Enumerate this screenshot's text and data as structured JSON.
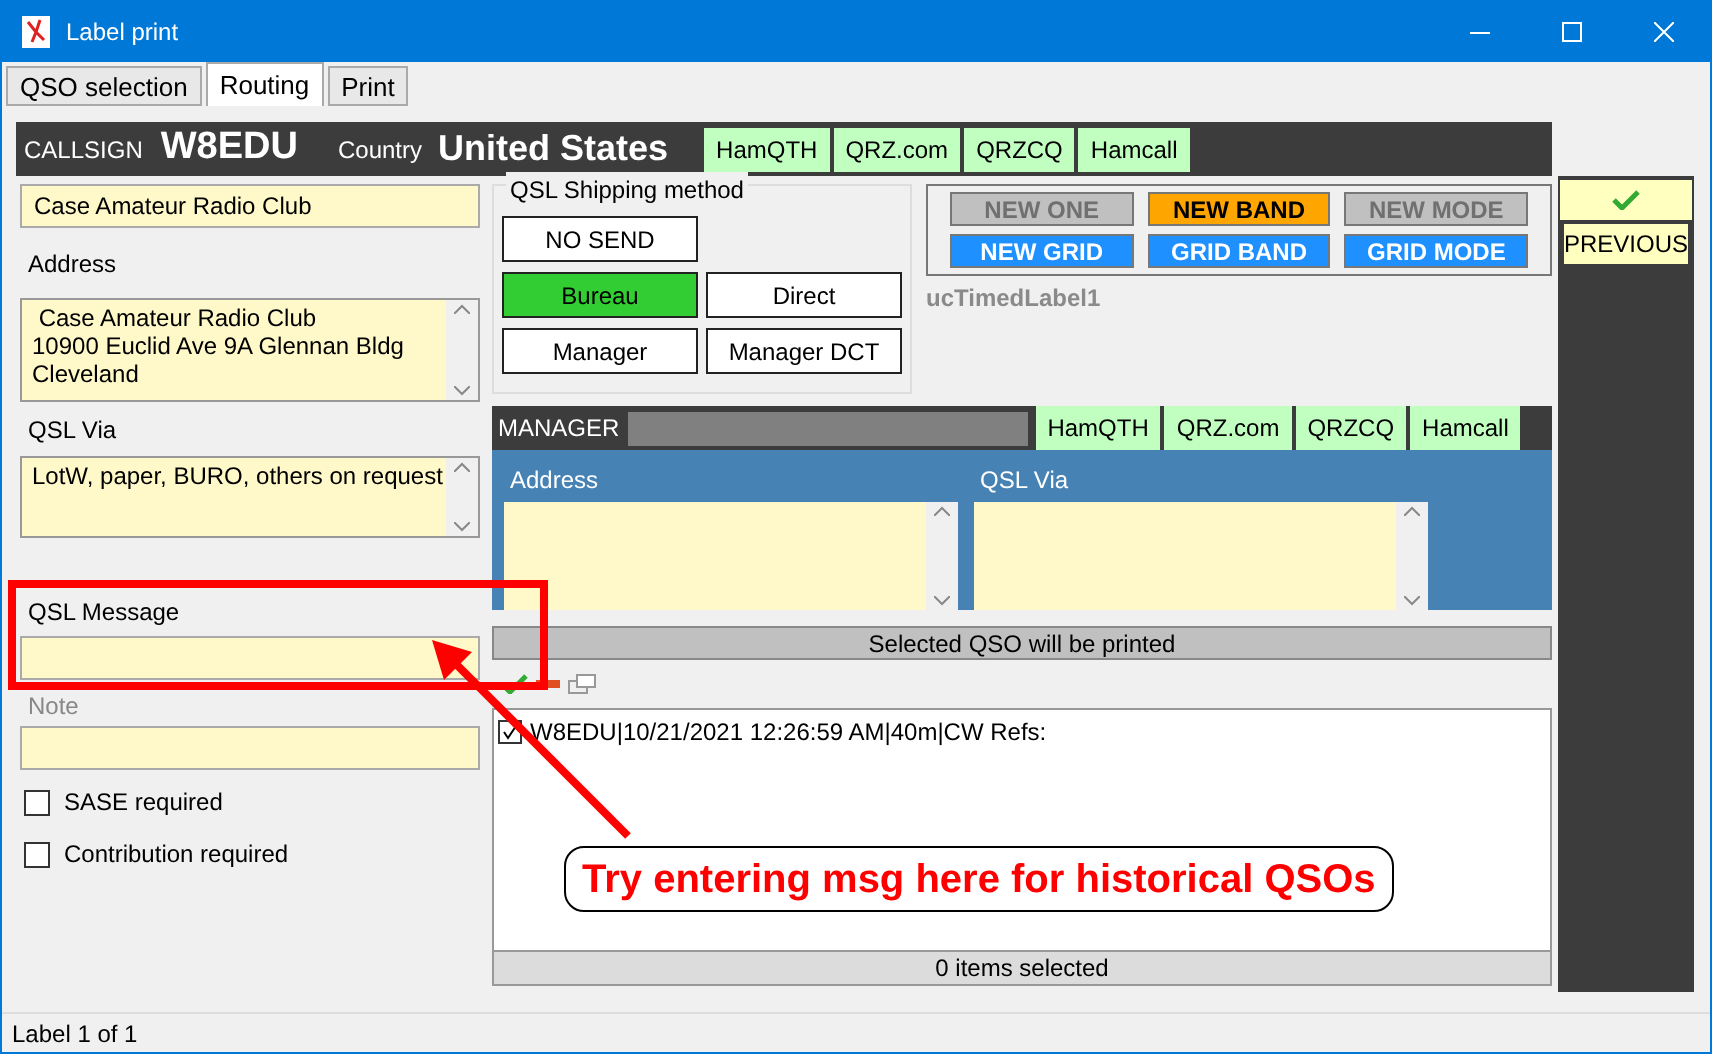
{
  "window": {
    "title": "Label print"
  },
  "tabs": [
    {
      "label": "QSO selection",
      "selected": false
    },
    {
      "label": "Routing",
      "selected": true
    },
    {
      "label": "Print",
      "selected": false
    }
  ],
  "callsign": {
    "label": "CALLSIGN",
    "value": "W8EDU"
  },
  "country": {
    "label": "Country",
    "value": "United States"
  },
  "lookup_buttons": [
    "HamQTH",
    "QRZ.com",
    "QRZCQ",
    "Hamcall"
  ],
  "name_field": {
    "value": "Case Amateur Radio Club"
  },
  "address": {
    "label": "Address",
    "lines": [
      " Case Amateur Radio Club",
      "10900 Euclid Ave 9A Glennan Bldg",
      "Cleveland"
    ]
  },
  "qsl_via": {
    "label": "QSL Via",
    "value": "LotW, paper, BURO, others on request"
  },
  "qsl_message": {
    "label": "QSL Message"
  },
  "note": {
    "label": "Note"
  },
  "checkboxes": [
    {
      "label": "SASE required",
      "checked": false
    },
    {
      "label": "Contribution required",
      "checked": false
    }
  ],
  "shipping": {
    "title": "QSL Shipping method",
    "buttons": [
      {
        "label": "NO SEND",
        "selected": false
      },
      {
        "label": "Bureau",
        "selected": true
      },
      {
        "label": "Direct",
        "selected": false
      },
      {
        "label": "Manager",
        "selected": false
      },
      {
        "label": "Manager DCT",
        "selected": false
      }
    ]
  },
  "award_flags": [
    {
      "label": "NEW ONE",
      "kind": "off",
      "color": "#c0c0c0"
    },
    {
      "label": "NEW BAND",
      "kind": "on",
      "color": "#ffa500"
    },
    {
      "label": "NEW MODE",
      "kind": "off",
      "color": "#c0c0c0"
    },
    {
      "label": "NEW GRID",
      "kind": "grid",
      "color": "#1e90ff"
    },
    {
      "label": "GRID BAND",
      "kind": "grid",
      "color": "#1e90ff"
    },
    {
      "label": "GRID MODE",
      "kind": "grid",
      "color": "#1e90ff"
    }
  ],
  "timed_label": "ucTimedLabel1",
  "side_panel": {
    "previous": "PREVIOUS"
  },
  "manager": {
    "label": "MANAGER",
    "lookup_buttons": [
      "HamQTH",
      "QRZ.com",
      "QRZCQ",
      "Hamcall"
    ],
    "address_label": "Address",
    "qsl_via_label": "QSL Via"
  },
  "selected_bar": "Selected QSO will be printed",
  "qso_list": [
    {
      "text": "W8EDU|10/21/2021 12:26:59 AM|40m|CW Refs:",
      "checked": true
    }
  ],
  "list_footer": "0 items selected",
  "status_bar": "Label 1 of 1",
  "annotation": "Try entering msg here for historical QSOs"
}
